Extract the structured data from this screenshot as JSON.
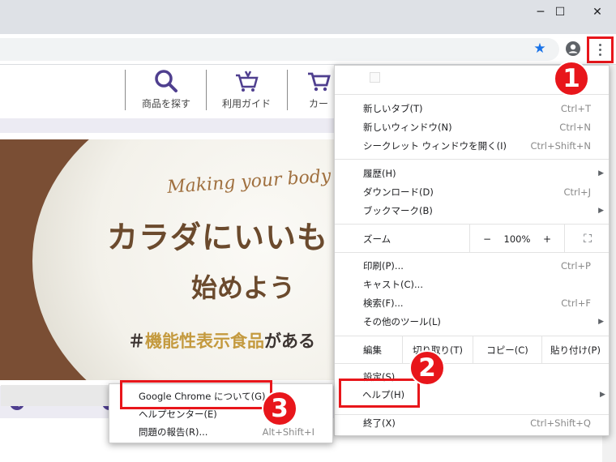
{
  "window": {
    "minimize_icon": "─",
    "maximize_icon": "☐",
    "close_icon": "✕"
  },
  "toolbar": {
    "bookmark_icon": "★",
    "colors": {
      "accent": "#1a73e8",
      "annotation": "#e8161b"
    }
  },
  "site": {
    "nav": [
      {
        "label": "商品を探す",
        "icon": "search-icon"
      },
      {
        "label": "利用ガイド",
        "icon": "cart-guide-icon"
      },
      {
        "label": "カー",
        "icon": "cart-icon"
      }
    ],
    "hero": {
      "script": "Making your body",
      "headline": "カラダにいいも",
      "subheadline": "始めよう",
      "tag_hash": "＃",
      "tag_highlight": "機能性表示食品",
      "tag_rest": "がある"
    }
  },
  "menu": {
    "new_tab": {
      "label": "新しいタブ(T)",
      "shortcut": "Ctrl+T"
    },
    "new_window": {
      "label": "新しいウィンドウ(N)",
      "shortcut": "Ctrl+N"
    },
    "incognito": {
      "label": "シークレット ウィンドウを開く(I)",
      "shortcut": "Ctrl+Shift+N"
    },
    "history": {
      "label": "履歴(H)"
    },
    "downloads": {
      "label": "ダウンロード(D)",
      "shortcut": "Ctrl+J"
    },
    "bookmarks": {
      "label": "ブックマーク(B)"
    },
    "zoom": {
      "label": "ズーム",
      "minus": "−",
      "value": "100%",
      "plus": "+",
      "fullscreen": "⛶"
    },
    "print": {
      "label": "印刷(P)...",
      "shortcut": "Ctrl+P"
    },
    "cast": {
      "label": "キャスト(C)..."
    },
    "find": {
      "label": "検索(F)...",
      "shortcut": "Ctrl+F"
    },
    "more_tools": {
      "label": "その他のツール(L)"
    },
    "edit": {
      "label": "編集",
      "cut": "切り取り(T)",
      "copy": "コピー(C)",
      "paste": "貼り付け(P)"
    },
    "settings": {
      "label": "設定(S)"
    },
    "help": {
      "label": "ヘルプ(H)"
    },
    "exit": {
      "label": "終了(X)",
      "shortcut": "Ctrl+Shift+Q"
    },
    "arrow": "▶"
  },
  "help_submenu": {
    "about": {
      "label": "Google Chrome について(G)"
    },
    "help_center": {
      "label": "ヘルプセンター(E)"
    },
    "report": {
      "label": "問題の報告(R)...",
      "shortcut": "Alt+Shift+I"
    }
  },
  "annotations": [
    "1",
    "2",
    "3"
  ]
}
